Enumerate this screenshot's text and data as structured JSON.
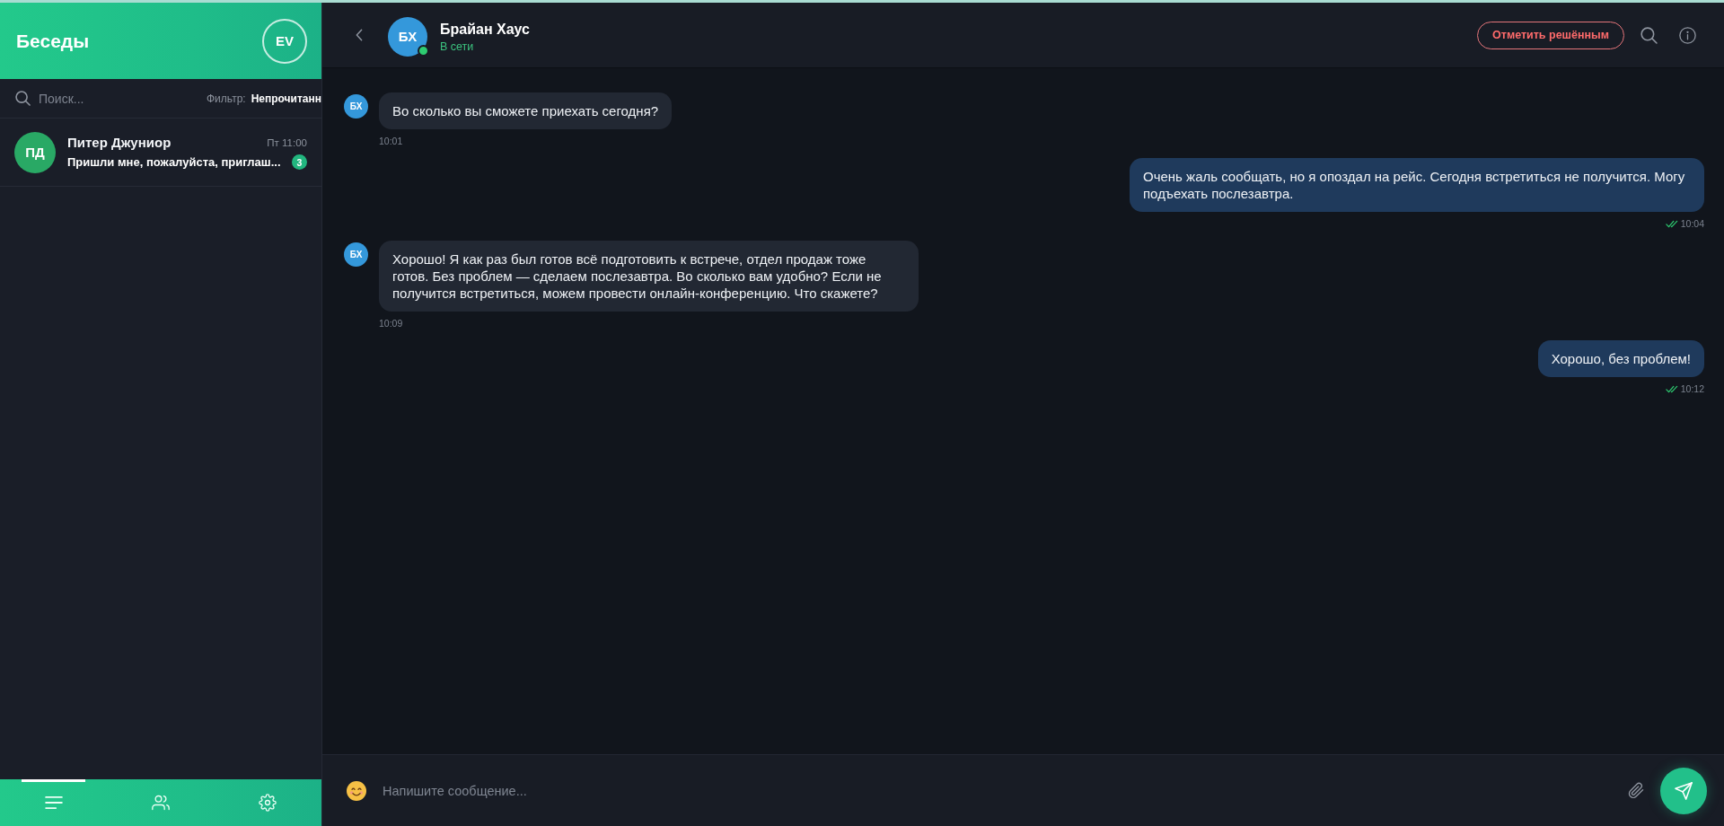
{
  "sidebar": {
    "title": "Беседы",
    "user_avatar": "EV",
    "search": {
      "placeholder": "Поиск..."
    },
    "filter": {
      "label": "Фильтр:",
      "value": "Непрочитанн"
    },
    "conversations": [
      {
        "initials": "ПД",
        "name": "Питер Джуниор",
        "time": "Пт 11:00",
        "preview": "Пришли мне, пожалуйста, приглаш...",
        "unread_count": "3"
      }
    ],
    "nav": [
      {
        "kind": "list",
        "selected": true
      },
      {
        "kind": "contacts",
        "selected": false
      },
      {
        "kind": "settings",
        "selected": false
      }
    ]
  },
  "chat": {
    "contact": {
      "initials": "БХ",
      "name": "Брайан Хаус",
      "status": "В сети",
      "online": true
    },
    "resolve_button": "Отметить решённым",
    "messages": [
      {
        "kind": "incoming",
        "initials": "БХ",
        "text": "Во сколько вы сможете приехать сегодня?",
        "time": "10:01"
      },
      {
        "kind": "outgoing",
        "text": "Очень жаль сообщать, но я опоздал на рейс. Сегодня встретиться не получится. Могу подъехать послезавтра.",
        "time": "10:04",
        "read": true
      },
      {
        "kind": "incoming",
        "initials": "БХ",
        "text": "Хорошо! Я как раз был готов всё подготовить к встрече, отдел продаж тоже готов. Без проблем — сделаем послезавтра. Во сколько вам удобно? Если не получится встретиться, можем провести онлайн-конференцию. Что скажете?",
        "time": "10:09"
      },
      {
        "kind": "outgoing",
        "text": "Хорошо, без проблем!",
        "time": "10:12",
        "read": true
      }
    ],
    "composer": {
      "placeholder": "Напишите сообщение..."
    }
  }
}
